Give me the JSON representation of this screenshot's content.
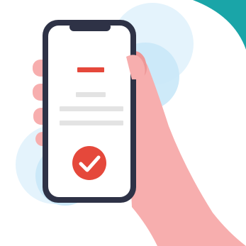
{
  "illustration": {
    "subject": "hand-holding-phone",
    "icons": {
      "confirmation": "check-circle-icon"
    },
    "colors": {
      "background": "#ffffff",
      "corner_accent": "#1aa5a8",
      "bubble_light": "#e4f3fc",
      "bubble_mid": "#c9e8f8",
      "skin": "#f7aeae",
      "skin_shadow": "#ee9797",
      "phone_frame": "#2e3246",
      "phone_screen": "#ffffff",
      "red_accent": "#e5483b",
      "placeholder_line": "#e3e3e3"
    }
  }
}
